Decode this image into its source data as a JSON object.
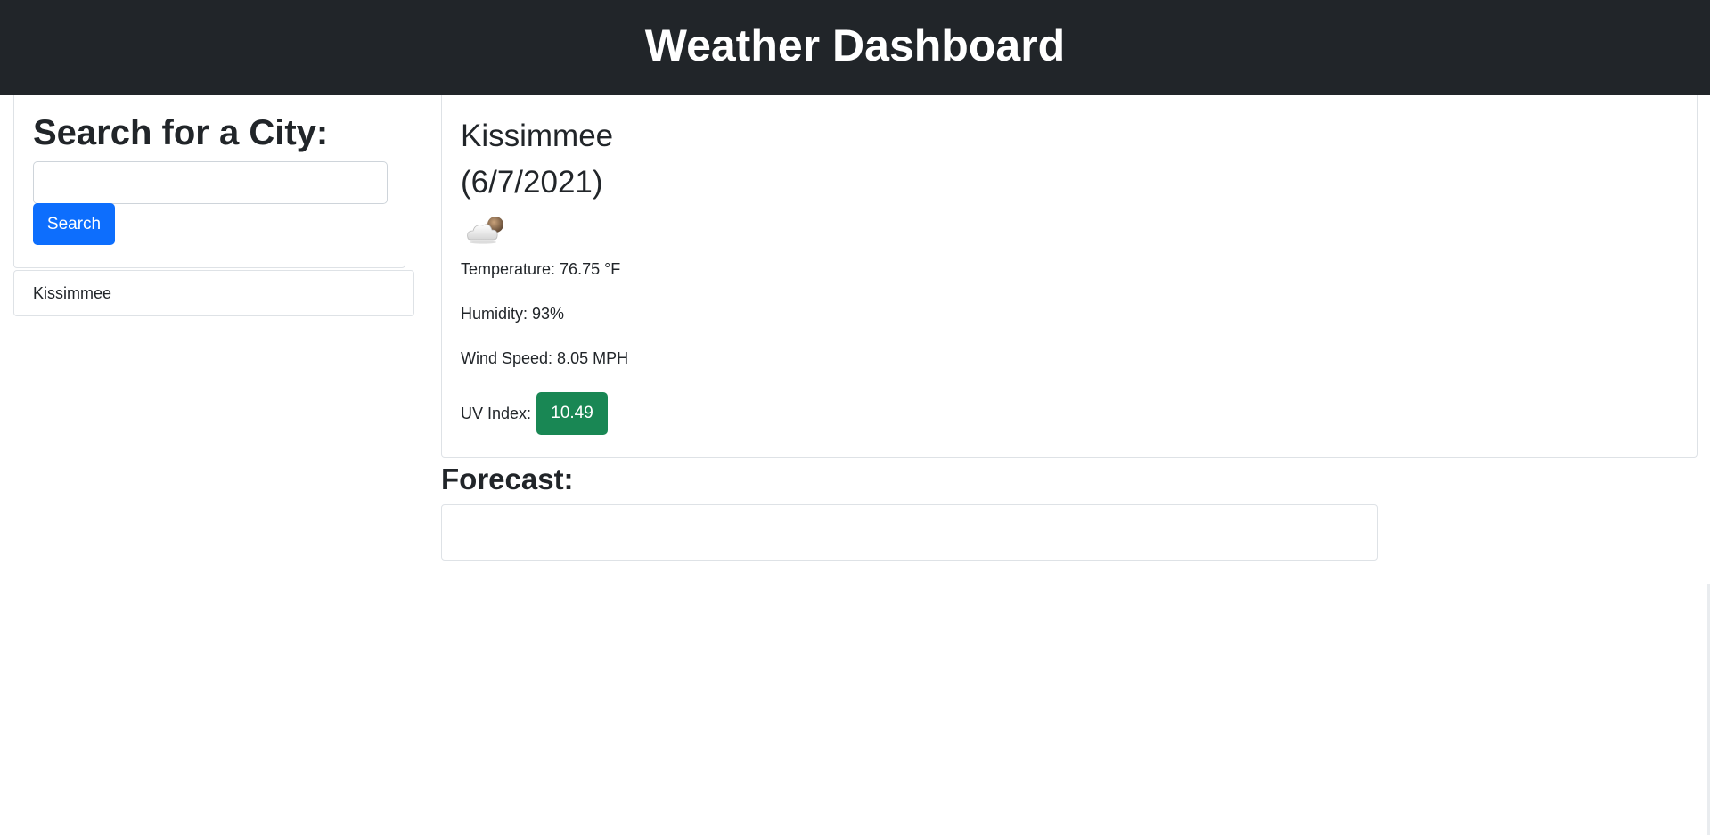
{
  "header": {
    "title": "Weather Dashboard"
  },
  "search": {
    "heading": "Search for a City:",
    "input_value": "",
    "placeholder": "",
    "button_label": "Search"
  },
  "history": {
    "items": [
      {
        "label": "Kissimmee"
      }
    ]
  },
  "current": {
    "city": "Kissimmee",
    "date": "(6/7/2021)",
    "icon": "partly-cloudy-night-icon",
    "temperature": "Temperature: 76.75 °F",
    "humidity": "Humidity: 93%",
    "wind": "Wind Speed: 8.05 MPH",
    "uv_label": "UV Index:",
    "uv_value": "10.49",
    "uv_color": "#198754"
  },
  "forecast": {
    "title": "Forecast:"
  },
  "colors": {
    "header_bg": "#212529",
    "accent": "#0d6efd"
  }
}
